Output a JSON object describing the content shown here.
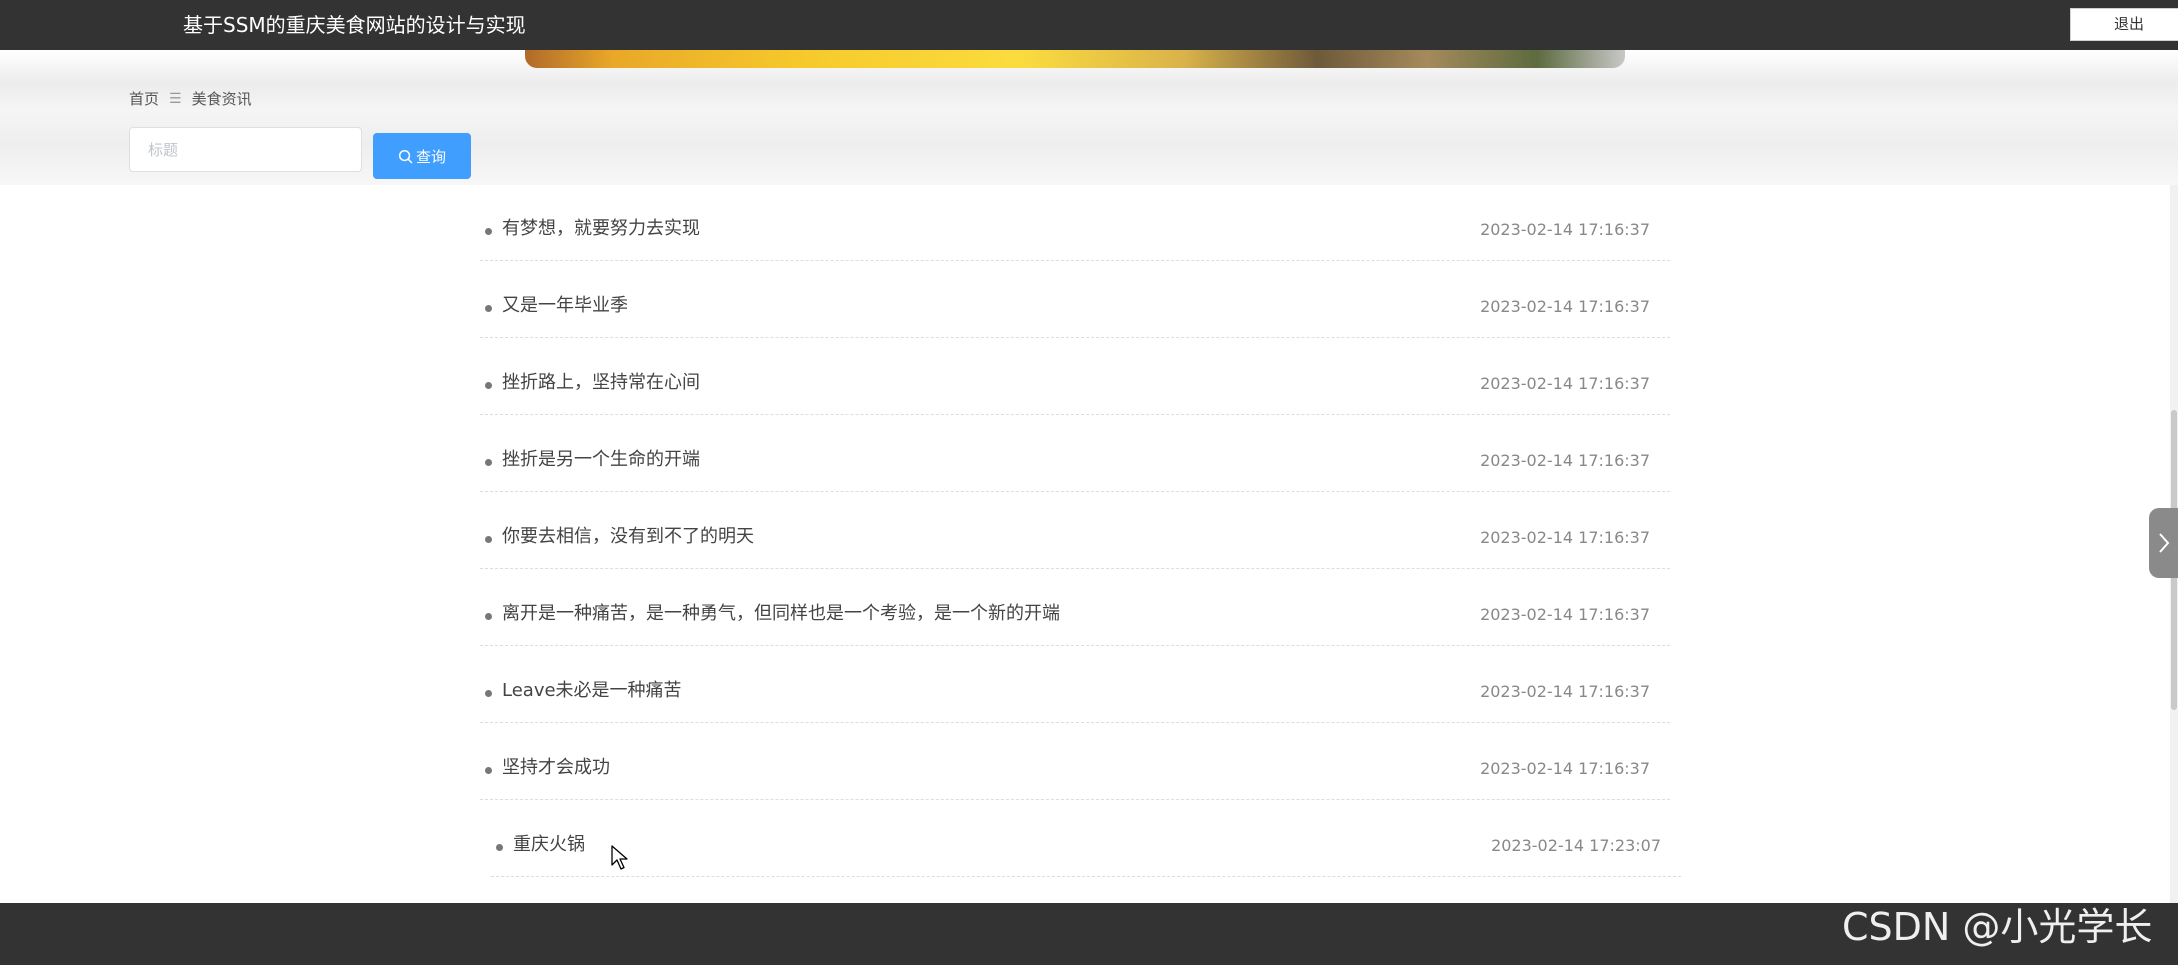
{
  "header": {
    "site_title": "基于SSM的重庆美食网站的设计与实现",
    "logout_label": "退出"
  },
  "breadcrumb": {
    "home": "首页",
    "separator": "☰",
    "current": "美食资讯"
  },
  "search": {
    "placeholder": "标题",
    "value": "",
    "button_label": "查询"
  },
  "news": [
    {
      "title": "有梦想，就要努力去实现",
      "date": "2023-02-14 17:16:37"
    },
    {
      "title": "又是一年毕业季",
      "date": "2023-02-14 17:16:37"
    },
    {
      "title": "挫折路上，坚持常在心间",
      "date": "2023-02-14 17:16:37"
    },
    {
      "title": "挫折是另一个生命的开端",
      "date": "2023-02-14 17:16:37"
    },
    {
      "title": "你要去相信，没有到不了的明天",
      "date": "2023-02-14 17:16:37"
    },
    {
      "title": "离开是一种痛苦，是一种勇气，但同样也是一个考验，是一个新的开端",
      "date": "2023-02-14 17:16:37"
    },
    {
      "title": "Leave未必是一种痛苦",
      "date": "2023-02-14 17:16:37"
    },
    {
      "title": "坚持才会成功",
      "date": "2023-02-14 17:16:37"
    },
    {
      "title": "重庆火锅",
      "date": "2023-02-14 17:23:07"
    }
  ],
  "watermark": "CSDN @小光学长",
  "colors": {
    "topbar": "#333333",
    "footer": "#333333",
    "primary_button": "#409eff"
  }
}
